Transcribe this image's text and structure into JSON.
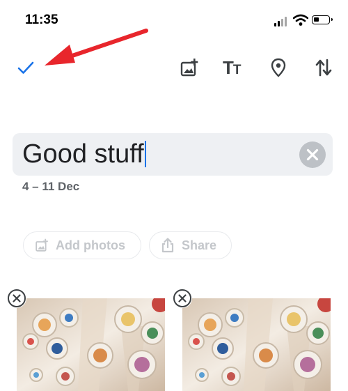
{
  "status_bar": {
    "time": "11:35"
  },
  "toolbar": {
    "done_icon": "checkmark-icon",
    "add_photo_icon": "add-photo-icon",
    "text_icon": "text-format-icon",
    "text_icon_glyph_large": "T",
    "text_icon_glyph_small": "T",
    "location_icon": "location-pin-icon",
    "sort_icon": "sort-arrows-icon",
    "accent_color": "#1a73e8"
  },
  "annotation": {
    "arrow_color": "#e8262c"
  },
  "album": {
    "title": "Good stuff",
    "date_range": "4 – 11 Dec"
  },
  "actions": {
    "add_photos_label": "Add photos",
    "share_label": "Share"
  },
  "photos": [
    {
      "description_icon": "photo-thumbnail"
    },
    {
      "description_icon": "photo-thumbnail"
    }
  ]
}
